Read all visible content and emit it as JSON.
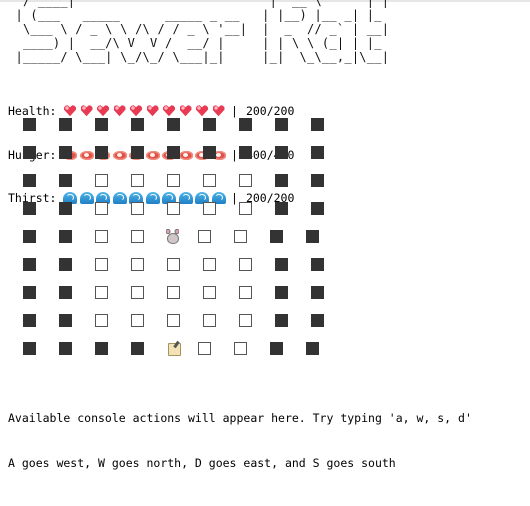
{
  "title_art": "  / ____|                          |  __ \\      | |\n | (___   _____      _____ _ __   | |__) |__ _| |_\n  \\___ \\ / _ \\ \\ /\\ / / _ \\ '__|  |  _  // _` | __|\n  ____) |  __/\\ V  V /  __/ |     | | \\ \\ (_| | |_\n |_____/ \\___| \\_/\\_/ \\___|_|     |_|  \\_\\__,_|\\__|",
  "stats": {
    "health": {
      "label": "Health:",
      "icon": "heart-icon",
      "count": 10,
      "separator": "|",
      "value": "200/200"
    },
    "hunger": {
      "label": "Hunger:",
      "icon": "meat-icon",
      "count": 10,
      "separator": "|",
      "value": "400/400"
    },
    "thirst": {
      "label": "Thirst:",
      "icon": "wave-icon",
      "count": 10,
      "separator": "|",
      "value": "200/200"
    }
  },
  "map": {
    "legend": {
      "W": "wall",
      "F": "floor",
      "P": "rat",
      "S": "scroll"
    },
    "rows": [
      "WWWWWWWWW",
      "WWWWWWWWW",
      "WWFFFFFWW",
      "WWFFFFFWW",
      "WWFFPFFWW",
      "WWFFFFFWW",
      "WWFFFFFWW",
      "WWFFFFFWW",
      "WWWWSFFWW"
    ]
  },
  "console": {
    "line1": "Available console actions will appear here. Try typing 'a, w, s, d'",
    "line2": "A goes west, W goes north, D goes east, and S goes south"
  }
}
